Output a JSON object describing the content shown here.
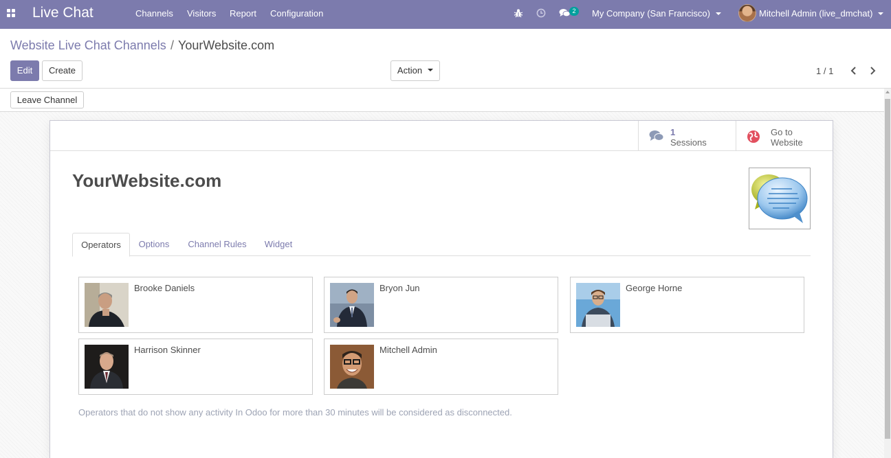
{
  "app": {
    "title": "Live Chat",
    "menu": [
      "Channels",
      "Visitors",
      "Report",
      "Configuration"
    ],
    "messages_count": "2",
    "company": "My Company (San Francisco)",
    "user": "Mitchell Admin (live_dmchat)"
  },
  "icons": {
    "apps": "apps-grid-icon",
    "bug": "bug-icon",
    "activity": "clock-icon",
    "messages": "comments-icon",
    "sessions": "comments-icon",
    "website": "globe-icon",
    "prev": "chevron-left-icon",
    "next": "chevron-right-icon"
  },
  "breadcrumb": {
    "parent": "Website Live Chat Channels",
    "separator": "/",
    "current": "YourWebsite.com"
  },
  "controls": {
    "edit": "Edit",
    "create": "Create",
    "action": "Action",
    "pager": "1 / 1"
  },
  "statusbar": {
    "leave": "Leave Channel"
  },
  "stats": {
    "sessions_value": "1",
    "sessions_label": "Sessions",
    "website_line1": "Go to",
    "website_line2": "Website"
  },
  "record": {
    "name": "YourWebsite.com"
  },
  "tabs": [
    "Operators",
    "Options",
    "Channel Rules",
    "Widget"
  ],
  "operators": [
    "Brooke Daniels",
    "Bryon Jun",
    "George Horne",
    "Harrison Skinner",
    "Mitchell Admin"
  ],
  "note": "Operators that do not show any activity In Odoo for more than 30 minutes will be considered as disconnected.",
  "colors": {
    "brand": "#7c7bad",
    "badge": "#00a09d",
    "link": "#7c7bad",
    "muted_note": "#9da3b4"
  }
}
